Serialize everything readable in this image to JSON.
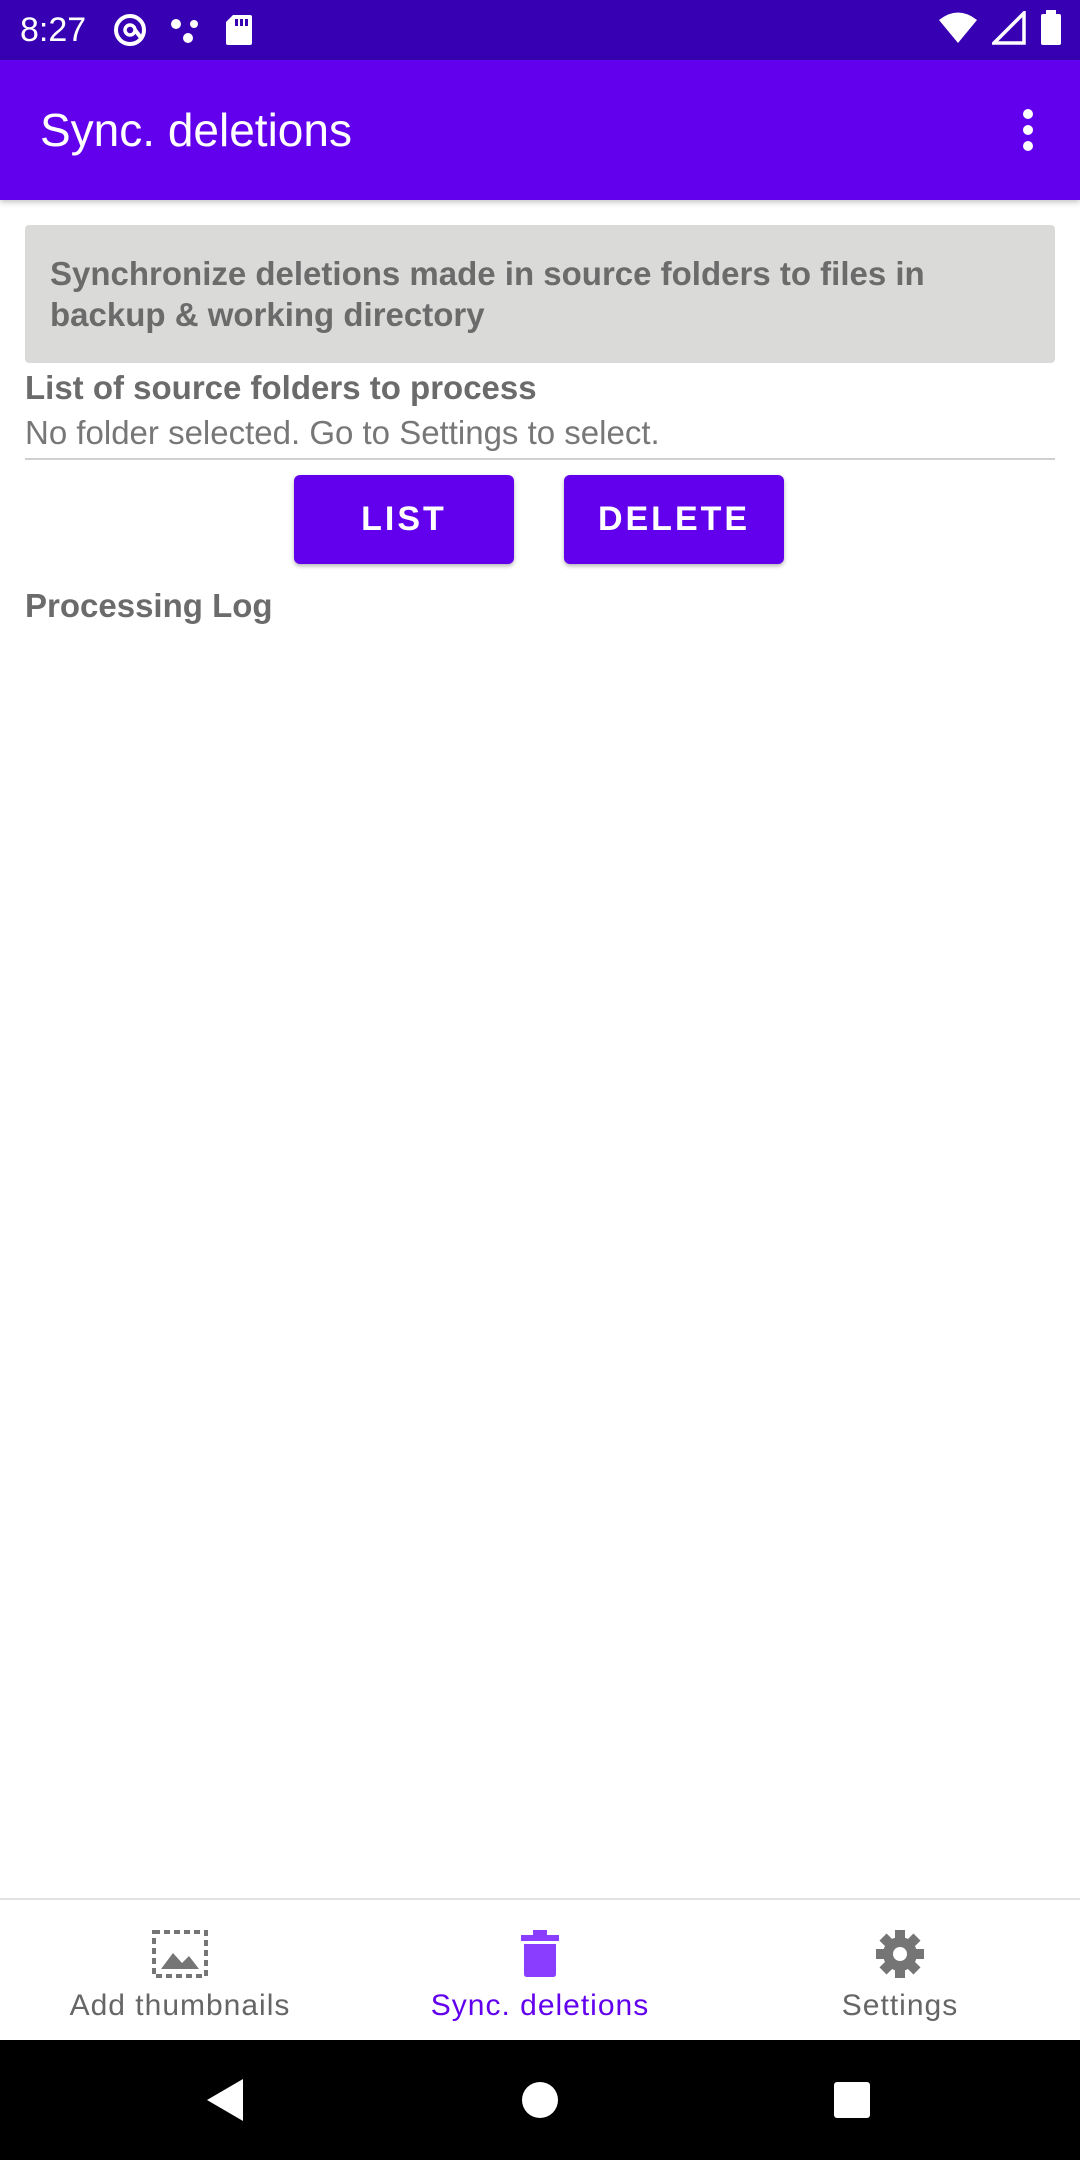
{
  "status_bar": {
    "time": "8:27",
    "left_icons": [
      "at-sign-icon",
      "dots-icon",
      "sd-card-icon"
    ],
    "right_icons": [
      "wifi-icon",
      "signal-icon",
      "battery-icon"
    ]
  },
  "app_bar": {
    "title": "Sync. deletions",
    "overflow_icon": "more-vert-icon"
  },
  "main": {
    "description": "Synchronize deletions made in source folders to files in backup & working directory",
    "source_label": "List of source folders to process",
    "source_value": "No folder selected. Go to Settings to select.",
    "buttons": {
      "list": "LIST",
      "delete": "DELETE"
    },
    "log_label": "Processing Log"
  },
  "bottom_nav": {
    "items": [
      {
        "label": "Add thumbnails",
        "icon": "image-icon",
        "selected": false
      },
      {
        "label": "Sync. deletions",
        "icon": "trash-icon",
        "selected": true
      },
      {
        "label": "Settings",
        "icon": "gear-icon",
        "selected": false
      }
    ]
  },
  "colors": {
    "status_bar": "#3700b3",
    "app_bar": "#6200ee",
    "button": "#6200ee",
    "selected_nav": "#6200ee",
    "description_bg": "#dadad8"
  },
  "system_nav": [
    "back-icon",
    "home-icon",
    "recents-icon"
  ]
}
